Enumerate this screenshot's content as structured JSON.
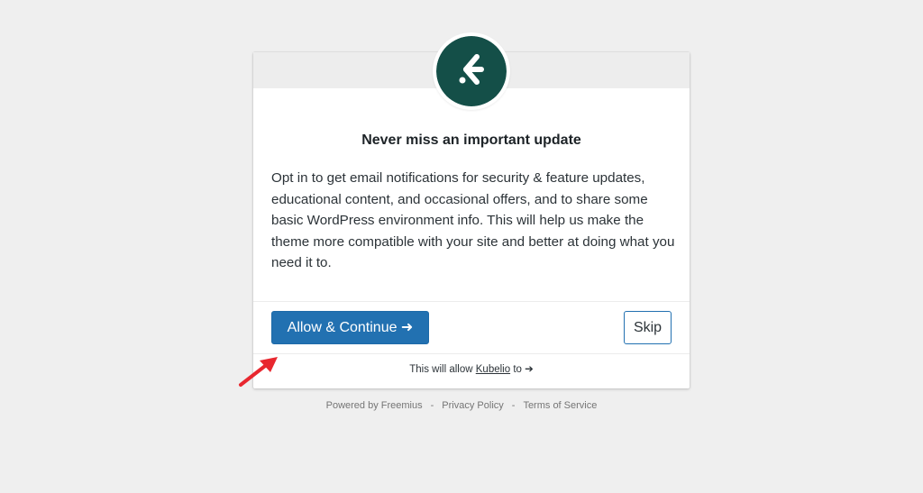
{
  "dialog": {
    "title": "Never miss an important update",
    "body": "Opt in to get email notifications for security & feature updates, educational content, and occasional offers, and to share some basic WordPress environment info. This will help us make the theme more compatible with your site and better at doing what you need it to.",
    "allow_button": "Allow & Continue ➜",
    "skip_button": "Skip",
    "permissions_prefix": "This will allow ",
    "permissions_link": "Kubelio",
    "permissions_suffix": " to ➔"
  },
  "footer": {
    "powered_by": "Powered by Freemius",
    "separator": "-",
    "privacy": "Privacy Policy",
    "terms": "Terms of Service"
  },
  "colors": {
    "logo_bg": "#144f48",
    "primary": "#2271b1",
    "annotation_arrow": "#e8272f"
  },
  "icons": {
    "logo": "kubelio-logo-icon",
    "annotation": "red-arrow-icon"
  }
}
